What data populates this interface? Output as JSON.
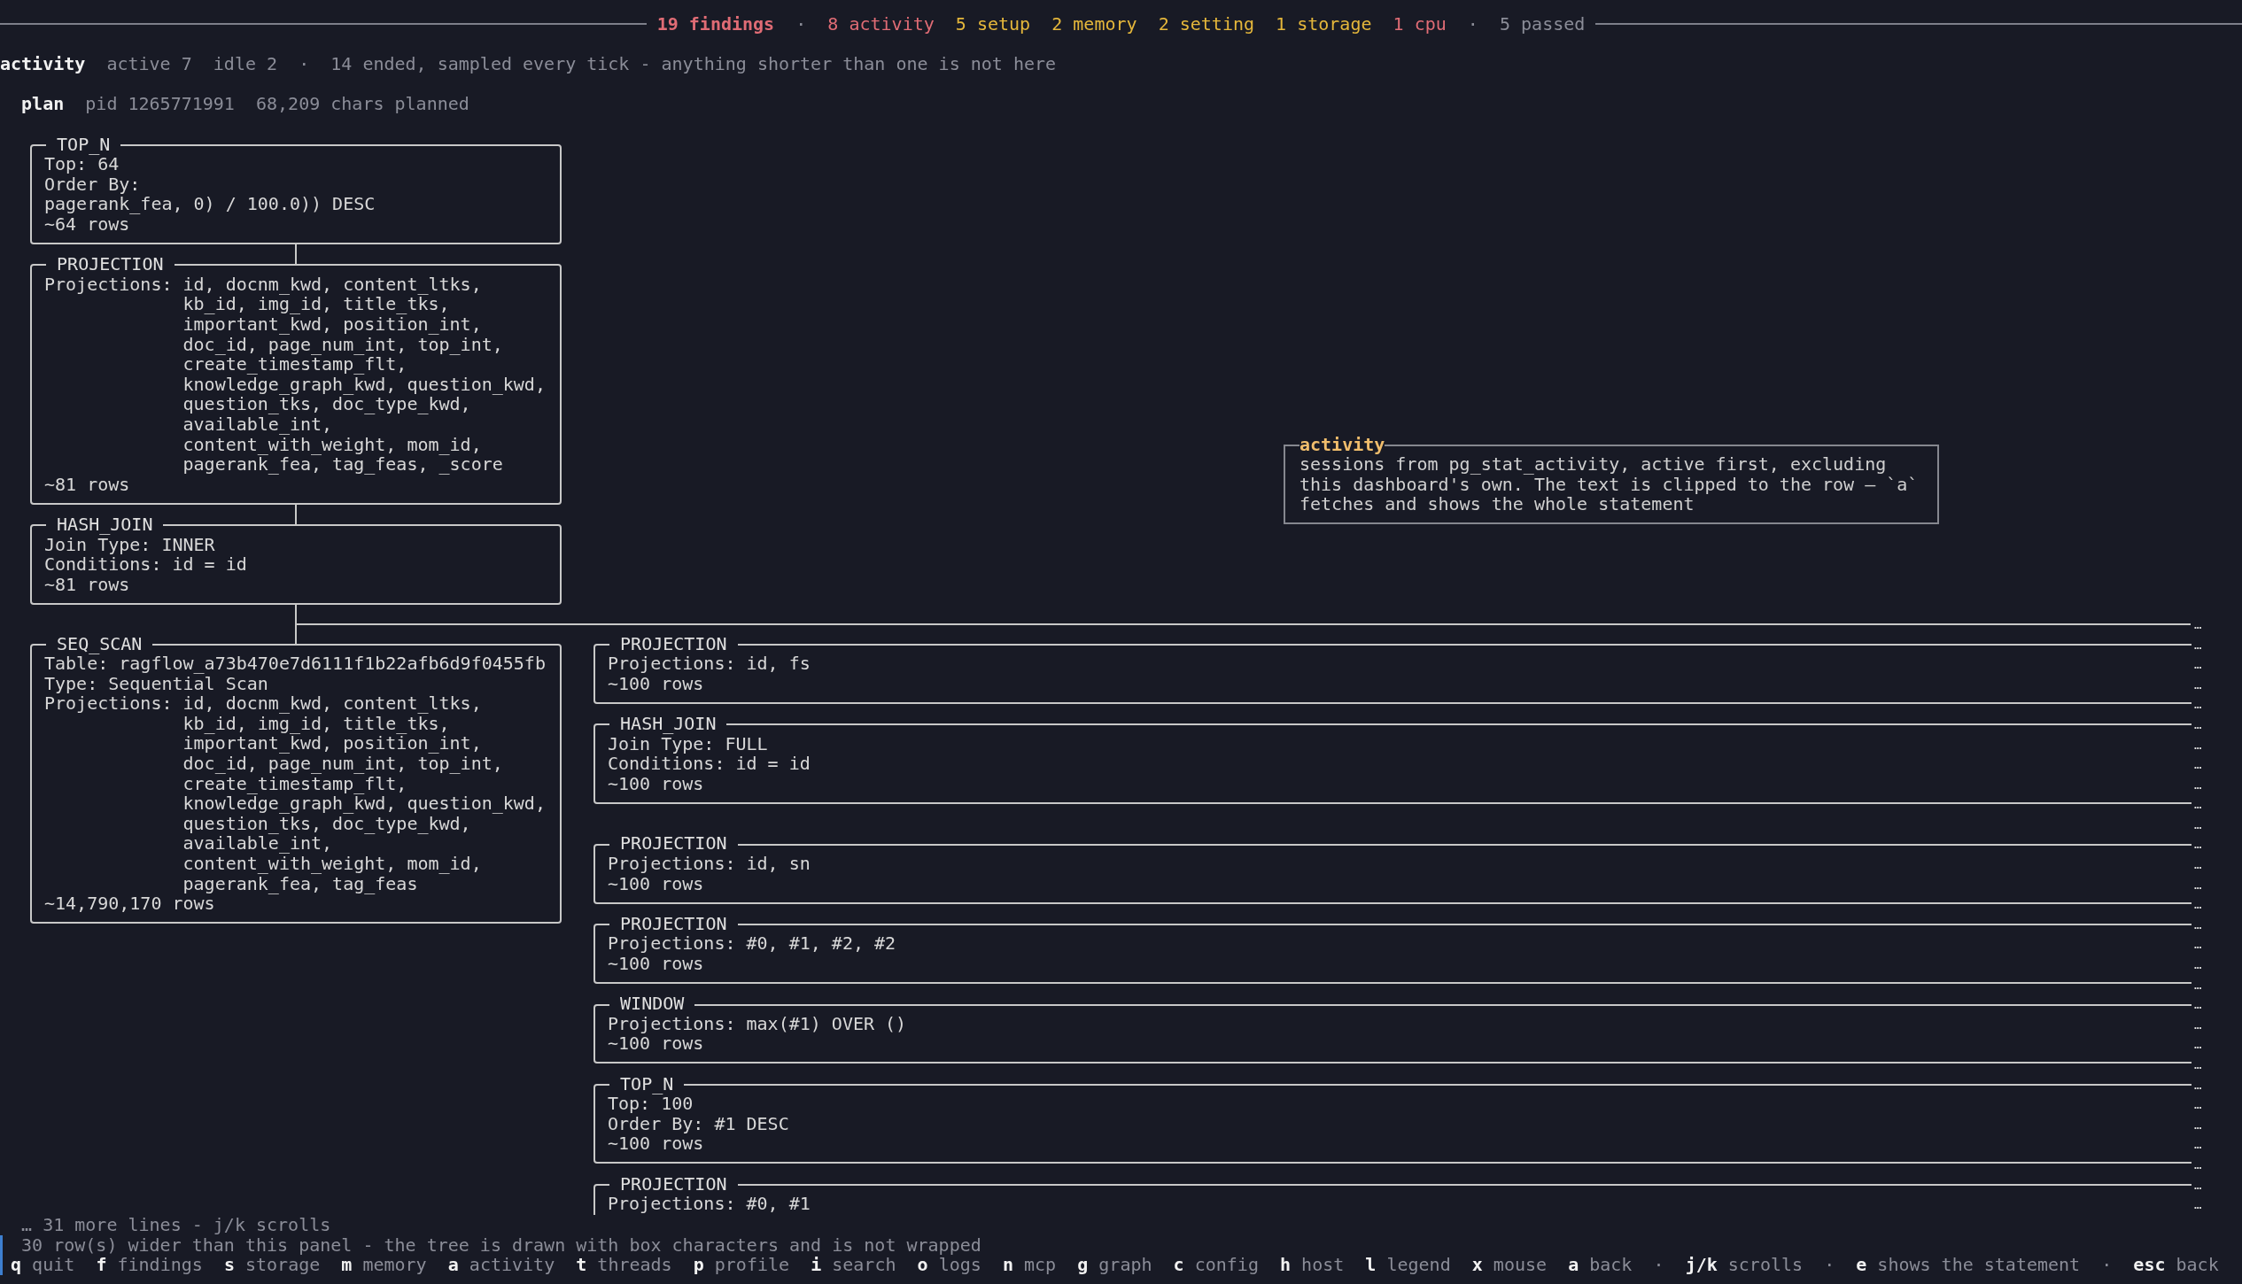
{
  "top_bar": {
    "total": "19 findings",
    "separator": "·",
    "categories": [
      {
        "label": "8 activity",
        "color": "#e06c75"
      },
      {
        "label": "5 setup",
        "color": "#e5b73b"
      },
      {
        "label": "2 memory",
        "color": "#e5b73b"
      },
      {
        "label": "2 setting",
        "color": "#e5b73b"
      },
      {
        "label": "1 storage",
        "color": "#e5b73b"
      },
      {
        "label": "1 cpu",
        "color": "#e06c75"
      }
    ],
    "passed": "5 passed"
  },
  "header": {
    "title": "activity",
    "stats": [
      "active 7",
      "idle 2"
    ],
    "separator": "·",
    "note": "14 ended, sampled every tick - anything shorter than one is not here"
  },
  "plan": {
    "title": "plan",
    "pid": "pid 1265771991",
    "size": "68,209 chars planned",
    "tree": {
      "title": "TOP_N",
      "lines": [
        {
          "kind": "text",
          "text": "Top: 64"
        },
        {
          "kind": "text",
          "text": "Order By:"
        },
        {
          "kind": "text",
          "text": "pagerank_fea, 0) / 100.0)) DESC"
        },
        {
          "kind": "text",
          "text": "~64 rows"
        }
      ],
      "children": [
        {
          "title": "PROJECTION",
          "lines": [
            {
              "kind": "list",
              "label": "Projections:",
              "items": [
                "id, docnm_kwd, content_ltks,",
                "kb_id, img_id, title_tks,",
                "important_kwd, position_int,",
                "doc_id, page_num_int, top_int,",
                "create_timestamp_flt,",
                "knowledge_graph_kwd, question_kwd,",
                "question_tks, doc_type_kwd,",
                "available_int,",
                "content_with_weight, mom_id,",
                "pagerank_fea, tag_feas, _score"
              ]
            },
            {
              "kind": "text",
              "text": "~81 rows"
            }
          ],
          "children": [
            {
              "title": "HASH_JOIN",
              "lines": [
                {
                  "kind": "text",
                  "text": "Join Type: INNER"
                },
                {
                  "kind": "text",
                  "text": "Conditions: id = id"
                },
                {
                  "kind": "text",
                  "text": "~81 rows"
                }
              ],
              "children": [
                {
                  "title": "SEQ_SCAN",
                  "lines": [
                    {
                      "kind": "text",
                      "text": "Table: ragflow_a73b470e7d6111f1b22afb6d9f0455fb"
                    },
                    {
                      "kind": "text",
                      "text": "Type: Sequential Scan"
                    },
                    {
                      "kind": "list",
                      "label": "Projections:",
                      "items": [
                        "id, docnm_kwd, content_ltks,",
                        "kb_id, img_id, title_tks,",
                        "important_kwd, position_int,",
                        "doc_id, page_num_int, top_int,",
                        "create_timestamp_flt,",
                        "knowledge_graph_kwd, question_kwd,",
                        "question_tks, doc_type_kwd,",
                        "available_int,",
                        "content_with_weight, mom_id,",
                        "pagerank_fea, tag_feas"
                      ]
                    },
                    {
                      "kind": "text",
                      "text": "~14,790,170 rows"
                    }
                  ]
                },
                {
                  "title": "PROJECTION",
                  "lines": [
                    {
                      "kind": "text",
                      "text": "Projections: id, fs"
                    },
                    {
                      "kind": "text",
                      "text": "~100 rows"
                    }
                  ],
                  "children": [
                    {
                      "title": "HASH_JOIN",
                      "off_panel_branch": true,
                      "lines": [
                        {
                          "kind": "text",
                          "text": "Join Type: FULL"
                        },
                        {
                          "kind": "text",
                          "text": "Conditions: id = id"
                        },
                        {
                          "kind": "text",
                          "text": "~100 rows"
                        }
                      ],
                      "children": [
                        {
                          "title": "PROJECTION",
                          "lines": [
                            {
                              "kind": "text",
                              "text": "Projections: id, sn"
                            },
                            {
                              "kind": "text",
                              "text": "~100 rows"
                            }
                          ],
                          "children": [
                            {
                              "title": "PROJECTION",
                              "lines": [
                                {
                                  "kind": "text",
                                  "text": "Projections: #0, #1, #2, #2"
                                },
                                {
                                  "kind": "text",
                                  "text": "~100 rows"
                                }
                              ],
                              "children": [
                                {
                                  "title": "WINDOW",
                                  "lines": [
                                    {
                                      "kind": "text",
                                      "text": "Projections: max(#1) OVER ()"
                                    },
                                    {
                                      "kind": "text",
                                      "text": "~100 rows"
                                    }
                                  ],
                                  "children": [
                                    {
                                      "title": "TOP_N",
                                      "lines": [
                                        {
                                          "kind": "text",
                                          "text": "Top: 100"
                                        },
                                        {
                                          "kind": "text",
                                          "text": "Order By: #1 DESC"
                                        },
                                        {
                                          "kind": "text",
                                          "text": "~100 rows"
                                        }
                                      ],
                                      "children": [
                                        {
                                          "title": "PROJECTION",
                                          "lines": [
                                            {
                                              "kind": "text",
                                              "text": "Projections: #0, #1"
                                            }
                                          ]
                                        }
                                      ]
                                    }
                                  ]
                                }
                              ]
                            }
                          ]
                        }
                      ]
                    }
                  ]
                }
              ]
            }
          ]
        }
      ]
    },
    "clip_marks": [
      "…",
      "…",
      "…",
      "…",
      "…",
      "…",
      "…",
      "…",
      "…",
      "…",
      "…",
      "…",
      "…",
      "…",
      "…",
      "…",
      "…",
      "…",
      "…",
      "…",
      "…",
      "…",
      "…",
      "…",
      "…",
      "…",
      "…",
      "…",
      "…",
      "…"
    ]
  },
  "popup": {
    "title": "activity",
    "text": "sessions from pg_stat_activity, active first, excluding this dashboard's own. The text is clipped to the row — `a` fetches and shows the whole statement"
  },
  "footer": {
    "more": "… 31 more lines - j/k scrolls",
    "notice": "30 row(s) wider than this panel - the tree is drawn with box characters and is not wrapped",
    "keys": [
      {
        "kind": "key",
        "key": "q",
        "label": "quit"
      },
      {
        "kind": "key",
        "key": "f",
        "label": "findings"
      },
      {
        "kind": "key",
        "key": "s",
        "label": "storage"
      },
      {
        "kind": "key",
        "key": "m",
        "label": "memory"
      },
      {
        "kind": "key",
        "key": "a",
        "label": "activity"
      },
      {
        "kind": "key",
        "key": "t",
        "label": "threads"
      },
      {
        "kind": "key",
        "key": "p",
        "label": "profile"
      },
      {
        "kind": "key",
        "key": "i",
        "label": "search"
      },
      {
        "kind": "key",
        "key": "o",
        "label": "logs"
      },
      {
        "kind": "key",
        "key": "n",
        "label": "mcp"
      },
      {
        "kind": "key",
        "key": "g",
        "label": "graph"
      },
      {
        "kind": "key",
        "key": "c",
        "label": "config"
      },
      {
        "kind": "key",
        "key": "h",
        "label": "host"
      },
      {
        "kind": "key",
        "key": "l",
        "label": "legend"
      },
      {
        "kind": "key",
        "key": "x",
        "label": "mouse"
      },
      {
        "kind": "key",
        "key": "a",
        "label": "back"
      },
      {
        "kind": "separator",
        "text": "·"
      },
      {
        "kind": "key",
        "key": "j/k",
        "label": "scrolls"
      },
      {
        "kind": "separator",
        "text": "·"
      },
      {
        "kind": "key",
        "key": "e",
        "label": "shows the statement"
      },
      {
        "kind": "separator",
        "text": "·"
      },
      {
        "kind": "key",
        "key": "esc",
        "label": "back"
      }
    ]
  }
}
